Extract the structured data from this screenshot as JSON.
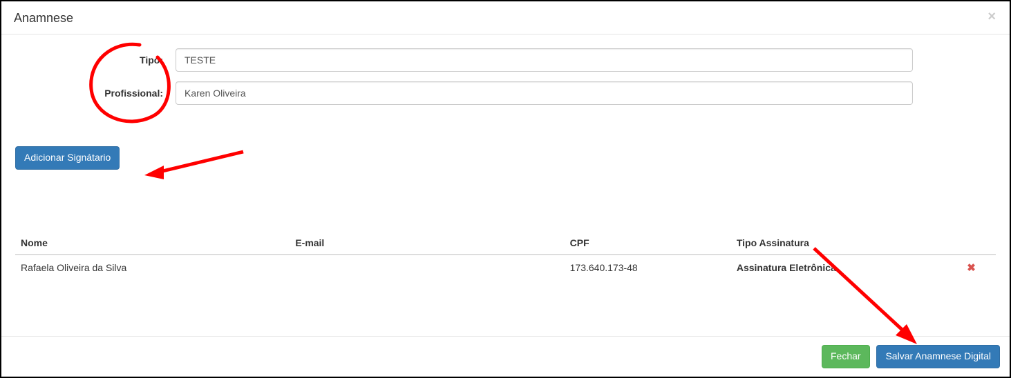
{
  "header": {
    "title": "Anamnese",
    "close_symbol": "×"
  },
  "form": {
    "tipo_label": "Tipo:",
    "tipo_value": "TESTE",
    "profissional_label": "Profissional:",
    "profissional_value": "Karen Oliveira"
  },
  "actions": {
    "add_signatory": "Adicionar Signátario"
  },
  "table": {
    "headers": {
      "nome": "Nome",
      "email": "E-mail",
      "cpf": "CPF",
      "tipo_assinatura": "Tipo Assinatura"
    },
    "rows": [
      {
        "nome": "Rafaela Oliveira da Silva",
        "email": "",
        "cpf": "173.640.173-48",
        "tipo_assinatura": "Assinatura Eletrônica"
      }
    ]
  },
  "footer": {
    "close": "Fechar",
    "save": "Salvar Anamnese Digital"
  },
  "icons": {
    "delete_symbol": "✖"
  }
}
